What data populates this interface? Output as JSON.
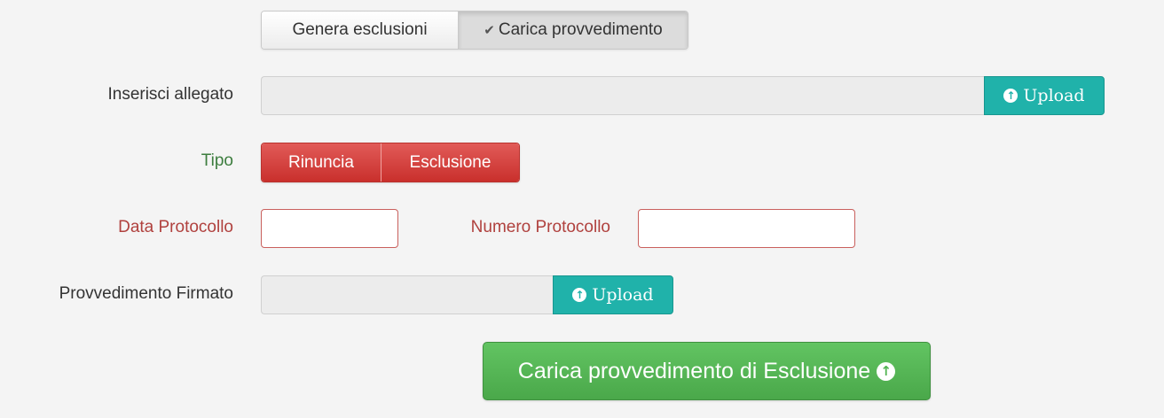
{
  "mode_toggle": {
    "options": [
      {
        "label": "Genera esclusioni",
        "selected": false
      },
      {
        "label": "Carica provvedimento",
        "selected": true
      }
    ]
  },
  "allegato": {
    "label": "Inserisci allegato",
    "value": "",
    "button_label": "Upload",
    "button_icon": "circle-arrow-up-icon"
  },
  "tipo": {
    "label": "Tipo",
    "options": [
      "Rinuncia",
      "Esclusione"
    ]
  },
  "data_protocollo": {
    "label": "Data Protocollo",
    "value": ""
  },
  "numero_protocollo": {
    "label": "Numero Protocollo",
    "value": ""
  },
  "provvedimento": {
    "label": "Provvedimento Firmato",
    "value": "",
    "button_label": "Upload",
    "button_icon": "circle-arrow-up-icon"
  },
  "submit": {
    "label": "Carica provvedimento di Esclusione",
    "icon": "circle-arrow-up-icon"
  },
  "colors": {
    "background": "#f4f4f4",
    "upload_teal": "#20b2aa",
    "danger_red": "#c9302c",
    "success_green": "#51b351",
    "label_green": "#3c7d3e",
    "label_red": "#b0413e"
  }
}
